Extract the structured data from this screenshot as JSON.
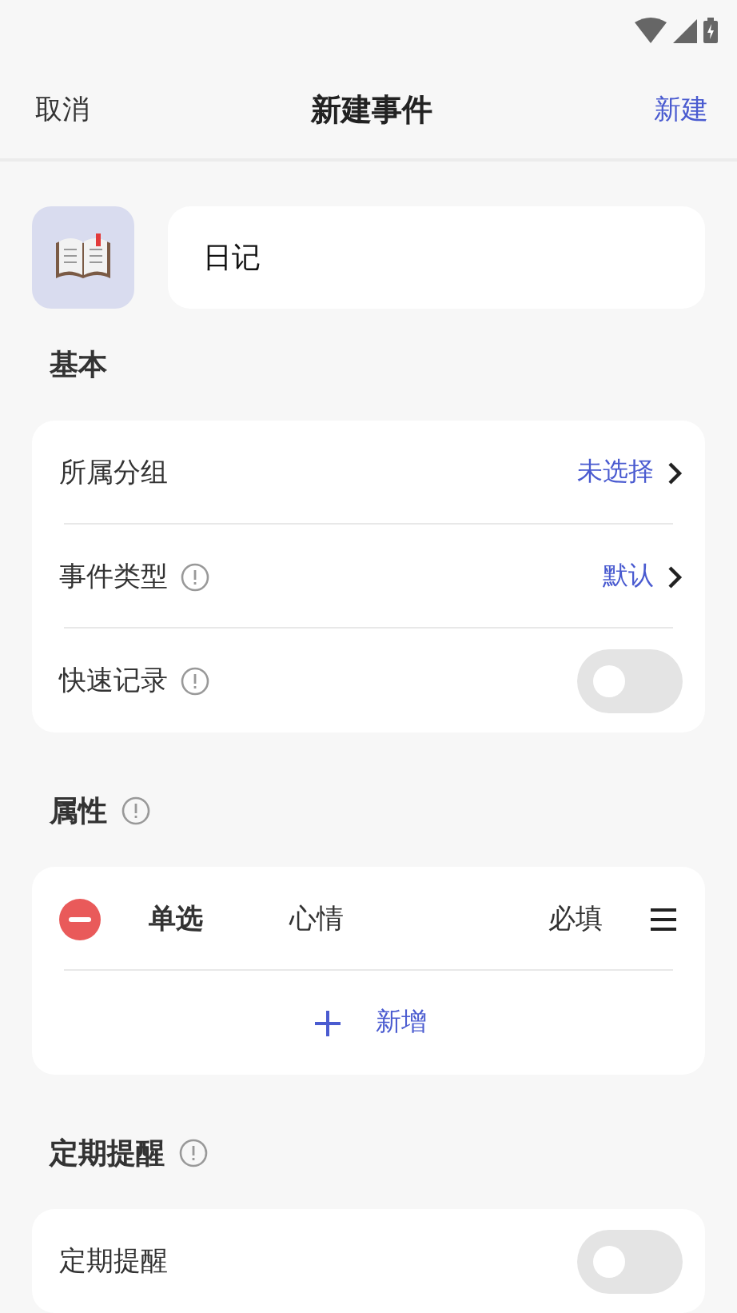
{
  "header": {
    "cancel": "取消",
    "title": "新建事件",
    "create": "新建"
  },
  "event": {
    "name": "日记"
  },
  "sections": [
    {
      "title": "基本",
      "info": false,
      "rows": [
        {
          "kind": "link",
          "label": "所属分组",
          "info": false,
          "value": "未选择"
        },
        {
          "kind": "link",
          "label": "事件类型",
          "info": true,
          "value": "默认"
        },
        {
          "kind": "toggle",
          "label": "快速记录",
          "info": true,
          "on": false
        }
      ]
    },
    {
      "title": "属性",
      "info": true,
      "rows": [
        {
          "kind": "attribute",
          "type": "单选",
          "name": "心情",
          "required": "必填"
        },
        {
          "kind": "add",
          "label": "新增"
        }
      ]
    },
    {
      "title": "定期提醒",
      "info": true,
      "rows": [
        {
          "kind": "toggle",
          "label": "定期提醒",
          "info": false,
          "on": false
        }
      ]
    }
  ]
}
